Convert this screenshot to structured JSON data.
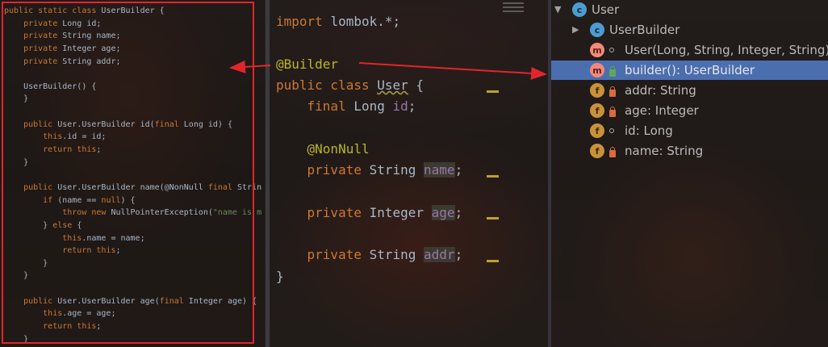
{
  "left_code": {
    "lines": [
      [
        {
          "t": "public static class ",
          "c": "k"
        },
        {
          "t": "UserBuilder {",
          "c": ""
        }
      ],
      [
        {
          "t": "    private ",
          "c": "k"
        },
        {
          "t": "Long id;",
          "c": ""
        }
      ],
      [
        {
          "t": "    private ",
          "c": "k"
        },
        {
          "t": "String name;",
          "c": ""
        }
      ],
      [
        {
          "t": "    private ",
          "c": "k"
        },
        {
          "t": "Integer age;",
          "c": ""
        }
      ],
      [
        {
          "t": "    private ",
          "c": "k"
        },
        {
          "t": "String addr;",
          "c": ""
        }
      ],
      [
        {
          "t": "",
          "c": ""
        }
      ],
      [
        {
          "t": "    UserBuilder() {",
          "c": ""
        }
      ],
      [
        {
          "t": "    }",
          "c": ""
        }
      ],
      [
        {
          "t": "",
          "c": ""
        }
      ],
      [
        {
          "t": "    public ",
          "c": "k"
        },
        {
          "t": "User.UserBuilder id(",
          "c": ""
        },
        {
          "t": "final ",
          "c": "k"
        },
        {
          "t": "Long id) {",
          "c": ""
        }
      ],
      [
        {
          "t": "        this",
          "c": "k"
        },
        {
          "t": ".id = id;",
          "c": ""
        }
      ],
      [
        {
          "t": "        return this",
          "c": "k"
        },
        {
          "t": ";",
          "c": ""
        }
      ],
      [
        {
          "t": "    }",
          "c": ""
        }
      ],
      [
        {
          "t": "",
          "c": ""
        }
      ],
      [
        {
          "t": "    public ",
          "c": "k"
        },
        {
          "t": "User.UserBuilder name(@NonNull ",
          "c": ""
        },
        {
          "t": "final ",
          "c": "k"
        },
        {
          "t": "Strin",
          "c": ""
        }
      ],
      [
        {
          "t": "        if ",
          "c": "k"
        },
        {
          "t": "(name == ",
          "c": ""
        },
        {
          "t": "null",
          "c": "k"
        },
        {
          "t": ") {",
          "c": ""
        }
      ],
      [
        {
          "t": "            throw new ",
          "c": "k"
        },
        {
          "t": "NullPointerException(",
          "c": ""
        },
        {
          "t": "\"name is m",
          "c": "s"
        }
      ],
      [
        {
          "t": "        } ",
          "c": ""
        },
        {
          "t": "else ",
          "c": "k"
        },
        {
          "t": "{",
          "c": ""
        }
      ],
      [
        {
          "t": "            this",
          "c": "k"
        },
        {
          "t": ".name = name;",
          "c": ""
        }
      ],
      [
        {
          "t": "            return this",
          "c": "k"
        },
        {
          "t": ";",
          "c": ""
        }
      ],
      [
        {
          "t": "        }",
          "c": ""
        }
      ],
      [
        {
          "t": "    }",
          "c": ""
        }
      ],
      [
        {
          "t": "",
          "c": ""
        }
      ],
      [
        {
          "t": "    public ",
          "c": "k"
        },
        {
          "t": "User.UserBuilder age(",
          "c": ""
        },
        {
          "t": "final ",
          "c": "k"
        },
        {
          "t": "Integer age) {",
          "c": ""
        }
      ],
      [
        {
          "t": "        this",
          "c": "k"
        },
        {
          "t": ".age = age;",
          "c": ""
        }
      ],
      [
        {
          "t": "        return this",
          "c": "k"
        },
        {
          "t": ";",
          "c": ""
        }
      ],
      [
        {
          "t": "    }",
          "c": ""
        }
      ]
    ]
  },
  "mid_code": {
    "lines": [
      [
        {
          "t": "import ",
          "c": "k"
        },
        {
          "t": "lombok.*;",
          "c": ""
        }
      ],
      [
        {
          "t": "",
          "c": ""
        }
      ],
      [
        {
          "t": "@Builder",
          "c": "ann"
        }
      ],
      [
        {
          "t": "public class ",
          "c": "k"
        },
        {
          "t": "User",
          "c": "cls"
        },
        {
          "t": " {",
          "c": ""
        }
      ],
      [
        {
          "t": "    final ",
          "c": "k"
        },
        {
          "t": "Long ",
          "c": ""
        },
        {
          "t": "id",
          "c": "fld"
        },
        {
          "t": ";",
          "c": ""
        }
      ],
      [
        {
          "t": "",
          "c": ""
        }
      ],
      [
        {
          "t": "    @NonNull",
          "c": "ann"
        }
      ],
      [
        {
          "t": "    private ",
          "c": "k"
        },
        {
          "t": "String ",
          "c": ""
        },
        {
          "t": "name",
          "c": "hl"
        },
        {
          "t": ";",
          "c": ""
        }
      ],
      [
        {
          "t": "",
          "c": ""
        }
      ],
      [
        {
          "t": "    private ",
          "c": "k"
        },
        {
          "t": "Integer ",
          "c": ""
        },
        {
          "t": "age",
          "c": "hl"
        },
        {
          "t": ";",
          "c": ""
        }
      ],
      [
        {
          "t": "",
          "c": ""
        }
      ],
      [
        {
          "t": "    private ",
          "c": "k"
        },
        {
          "t": "String ",
          "c": ""
        },
        {
          "t": "addr",
          "c": "hl"
        },
        {
          "t": ";",
          "c": ""
        }
      ],
      [
        {
          "t": "}",
          "c": ""
        }
      ]
    ]
  },
  "structure": {
    "rows": [
      {
        "label": "User",
        "icon": "c",
        "icon_name": "class-icon",
        "expanded": true,
        "indent": 0,
        "vis": "none",
        "selected": false
      },
      {
        "label": "UserBuilder",
        "icon": "cc",
        "icon_name": "inner-class-icon",
        "expanded": false,
        "indent": 1,
        "vis": "none",
        "selected": false
      },
      {
        "label": "User(Long, String, Integer, String)",
        "icon": "m",
        "icon_name": "method-icon",
        "indent": 1,
        "vis": "package",
        "selected": false
      },
      {
        "label": "builder(): UserBuilder",
        "icon": "m",
        "icon_name": "method-icon",
        "indent": 1,
        "vis": "public",
        "selected": true
      },
      {
        "label": "addr: String",
        "icon": "f",
        "icon_name": "field-icon",
        "indent": 1,
        "vis": "private",
        "selected": false
      },
      {
        "label": "age: Integer",
        "icon": "f",
        "icon_name": "field-icon",
        "indent": 1,
        "vis": "private",
        "selected": false
      },
      {
        "label": "id: Long",
        "icon": "f",
        "icon_name": "field-icon",
        "indent": 1,
        "vis": "package",
        "selected": false
      },
      {
        "label": "name: String",
        "icon": "f",
        "icon_name": "field-icon",
        "indent": 1,
        "vis": "private",
        "selected": false
      }
    ]
  },
  "colors": {
    "keyword": "#cc7832",
    "annotation": "#bbb529",
    "field": "#9876aa",
    "text": "#a9b7c6",
    "string": "#6a8759",
    "selection": "#4b6eaf",
    "highlight_box": "#e0262a"
  }
}
